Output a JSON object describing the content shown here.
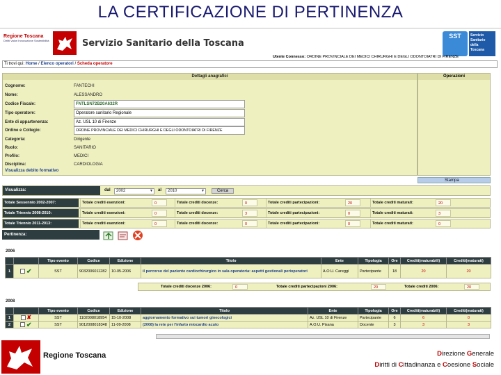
{
  "slide": {
    "title": "LA CERTIFICAZIONE DI PERTINENZA"
  },
  "header": {
    "region_name": "Regione Toscana",
    "region_sub": "Diritti Valori Innovazione Sostenibilità",
    "app_title": "Servizio Sanitario della Toscana",
    "sst_badge": "SST",
    "sst_text_lines": [
      "Servizio",
      "Sanitario",
      "della",
      "Toscana"
    ],
    "utente_label": "Utente Connesso:",
    "utente_value": "ORDINE PROVINCIALE DEI MEDICI CHIRURGHI E DEGLI ODONTOIATRI DI FIRENZE"
  },
  "breadcrumb": {
    "prefix": "Ti trovi qui:",
    "items": [
      "Home",
      "Elenco operatori",
      "Scheda operatore"
    ],
    "sep": "/"
  },
  "dettagli": {
    "header": "Dettagli anagrafici",
    "fields": [
      {
        "label": "Cognome:",
        "value": "FANTECHI",
        "boxed": false
      },
      {
        "label": "Nome:",
        "value": "ALESSANDRO",
        "boxed": false
      },
      {
        "label": "Codice Fiscale:",
        "value": "FNTLSN72B20A632R",
        "boxed": true
      },
      {
        "label": "Tipo operatore:",
        "value": "Operatore sanitario Regionale",
        "boxed": true
      },
      {
        "label": "Ente di appartenenza:",
        "value": "Az. USL 10 di Firenze",
        "boxed": true
      },
      {
        "label": "Ordine e Collegio:",
        "value": "ORDINE PROVINCIALE DEI MEDICI CHIRURGHI E DEGLI ODONTOIATRI DI FIRENZE",
        "boxed": true
      },
      {
        "label": "Categoria:",
        "value": "Dirigente",
        "boxed": false
      },
      {
        "label": "Ruolo:",
        "value": "SANITARIO",
        "boxed": false
      },
      {
        "label": "Profilo:",
        "value": "MEDICI",
        "boxed": false
      },
      {
        "label": "Disciplina:",
        "value": "CARDIOLOGIA",
        "boxed": false
      }
    ],
    "debito_link": "Visualizza debito formativo"
  },
  "operazioni": {
    "header": "Operazioni",
    "stampa": "Stampa"
  },
  "filtro": {
    "label": "Visualizza:",
    "dal_label": "dal",
    "dal_value": "2002",
    "al_label": "al",
    "al_value": "2010",
    "cerca": "Cerca"
  },
  "totali": [
    {
      "label": "Totale Sessennio 2002-2007:",
      "esenzioni_label": "Totale crediti esenzioni:",
      "esenzioni": "0",
      "docenze_label": "Totale crediti docenze:",
      "docenze": "0",
      "partecipazioni_label": "Totale crediti partecipazioni:",
      "partecipazioni": "20",
      "maturati_label": "Totale crediti maturati:",
      "maturati": "20"
    },
    {
      "label": "Totale Triennio 2008-2010:",
      "esenzioni_label": "Totale crediti esenzioni:",
      "esenzioni": "0",
      "docenze_label": "Totale crediti docenze:",
      "docenze": "3",
      "partecipazioni_label": "Totale crediti partecipazioni:",
      "partecipazioni": "0",
      "maturati_label": "Totale crediti maturati:",
      "maturati": "3"
    },
    {
      "label": "Totale Triennio 2011-2013:",
      "esenzioni_label": "Totale crediti esenzioni:",
      "esenzioni": "0",
      "docenze_label": "Totale crediti docenze:",
      "docenze": "0",
      "partecipazioni_label": "Totale crediti partecipazioni:",
      "partecipazioni": "0",
      "maturati_label": "Totale crediti maturati:",
      "maturati": "0"
    }
  ],
  "pertinenza": {
    "label": "Pertinenza:"
  },
  "columns": [
    "Tipo evento",
    "Codice",
    "Edizione",
    "Titolo",
    "Ente",
    "Tipologia",
    "Ore",
    "Crediti(maturabili)",
    "Crediti(maturati)"
  ],
  "year2006": {
    "year": "2006",
    "rows": [
      {
        "n": "1",
        "status": "ok",
        "tipo": "SST",
        "codice": "9032006011282",
        "edizione": "10-05-2006",
        "titolo": "il percorso del paziente cardiochirurgico in sala operatoria: aspetti gestionali perioperatori",
        "ente": "A.O.U. Careggi",
        "tipologia": "Partecipante",
        "ore": "18",
        "maturabili": "20",
        "maturati": "20"
      }
    ],
    "sum_docenze_label": "Totale crediti docenze 2006:",
    "sum_docenze": "0",
    "sum_partecipazioni_label": "Totale crediti partecipazioni 2006:",
    "sum_partecipazioni": "20",
    "sum_crediti_label": "Totale crediti 2006:",
    "sum_crediti": "20"
  },
  "year2008": {
    "year": "2008",
    "rows": [
      {
        "n": "1",
        "status": "ko",
        "tipo": "SST",
        "codice": "1102008018954",
        "edizione": "15-10-2008",
        "titolo": "aggiornamento formativo sui tumori ginecologici",
        "ente": "Az. USL 10 di Firenze",
        "tipologia": "Partecipante",
        "ore": "6",
        "maturabili": "6",
        "maturati": "0"
      },
      {
        "n": "2",
        "status": "ok",
        "tipo": "SST",
        "codice": "9012008018348",
        "edizione": "11-09-2008",
        "titolo": "(2008) la rete per l'infarto miocardio acuto",
        "ente": "A.O.U. Pisana",
        "tipologia": "Docente",
        "ore": "3",
        "maturabili": "3",
        "maturati": "3"
      }
    ]
  },
  "footer": {
    "region_name": "Regione Toscana",
    "line1": "Direzione Generale",
    "line2": "Diritti di Cittadinanza e Coesione Sociale"
  },
  "colors": {
    "accent_red": "#c00000",
    "panel": "#eff0c0",
    "dark_header": "#2e3d40",
    "link_blue": "#1b3f8b",
    "title_navy": "#1a1a70"
  }
}
